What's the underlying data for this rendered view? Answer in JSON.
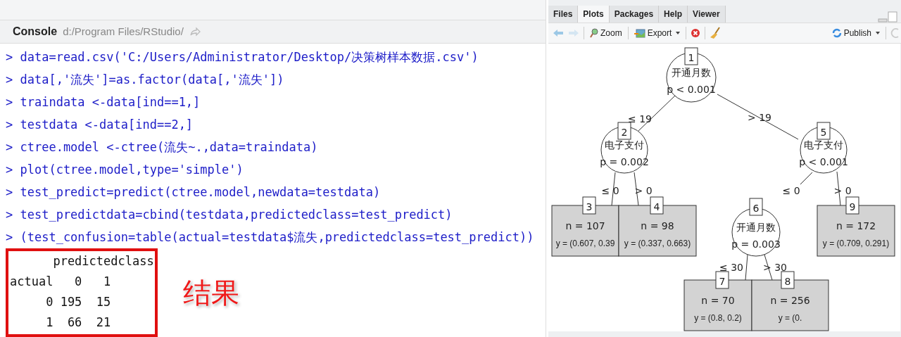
{
  "console": {
    "title": "Console",
    "path": "d:/Program Files/RStudio/",
    "commands": [
      "> data=read.csv('C:/Users/Administrator/Desktop/决策树样本数据.csv')",
      "> data[,'流失']=as.factor(data[,'流失'])",
      "> traindata <-data[ind==1,]",
      "> testdata <-data[ind==2,]",
      "> ctree.model <-ctree(流失~.,data=traindata)",
      "> plot(ctree.model,type='simple')",
      "> test_predict=predict(ctree.model,newdata=testdata)",
      "> test_predictdata=cbind(testdata,predictedclass=test_predict)",
      "> (test_confusion=table(actual=testdata$流失,predictedclass=test_predict))"
    ],
    "output": [
      "      predictedclass",
      "actual   0   1",
      "     0 195  15",
      "     1  66  21"
    ],
    "annotation": "结果"
  },
  "plots_pane": {
    "tabs": [
      {
        "label": "Files",
        "selected": false
      },
      {
        "label": "Plots",
        "selected": true
      },
      {
        "label": "Packages",
        "selected": false
      },
      {
        "label": "Help",
        "selected": false
      },
      {
        "label": "Viewer",
        "selected": false
      }
    ],
    "toolbar": {
      "zoom": "Zoom",
      "export": "Export",
      "publish": "Publish"
    },
    "tree": {
      "nodes": [
        {
          "id": "1",
          "kind": "split",
          "variable": "开通月数",
          "p": "p < 0.001"
        },
        {
          "id": "2",
          "kind": "split",
          "variable": "电子支付",
          "p": "p = 0.002"
        },
        {
          "id": "5",
          "kind": "split",
          "variable": "电子支付",
          "p": "p < 0.001"
        },
        {
          "id": "3",
          "kind": "leaf",
          "n": "n = 107",
          "y": "y = (0.607, 0.39"
        },
        {
          "id": "4",
          "kind": "leaf",
          "n": "n = 98",
          "y": "y = (0.337, 0.663)"
        },
        {
          "id": "6",
          "kind": "split",
          "variable": "开通月数",
          "p": "p = 0.003"
        },
        {
          "id": "9",
          "kind": "leaf",
          "n": "n = 172",
          "y": "y = (0.709, 0.291)"
        },
        {
          "id": "7",
          "kind": "leaf",
          "n": "n = 70",
          "y": "y = (0.8, 0.2)"
        },
        {
          "id": "8",
          "kind": "leaf",
          "n": "n = 256",
          "y": "y = (0."
        }
      ],
      "edges": [
        {
          "label": "≤ 19"
        },
        {
          "label": "> 19"
        },
        {
          "label": "≤ 0"
        },
        {
          "label": "> 0"
        },
        {
          "label": "≤ 0"
        },
        {
          "label": "> 0"
        },
        {
          "label": "≤ 30"
        },
        {
          "label": "> 30"
        }
      ]
    }
  }
}
